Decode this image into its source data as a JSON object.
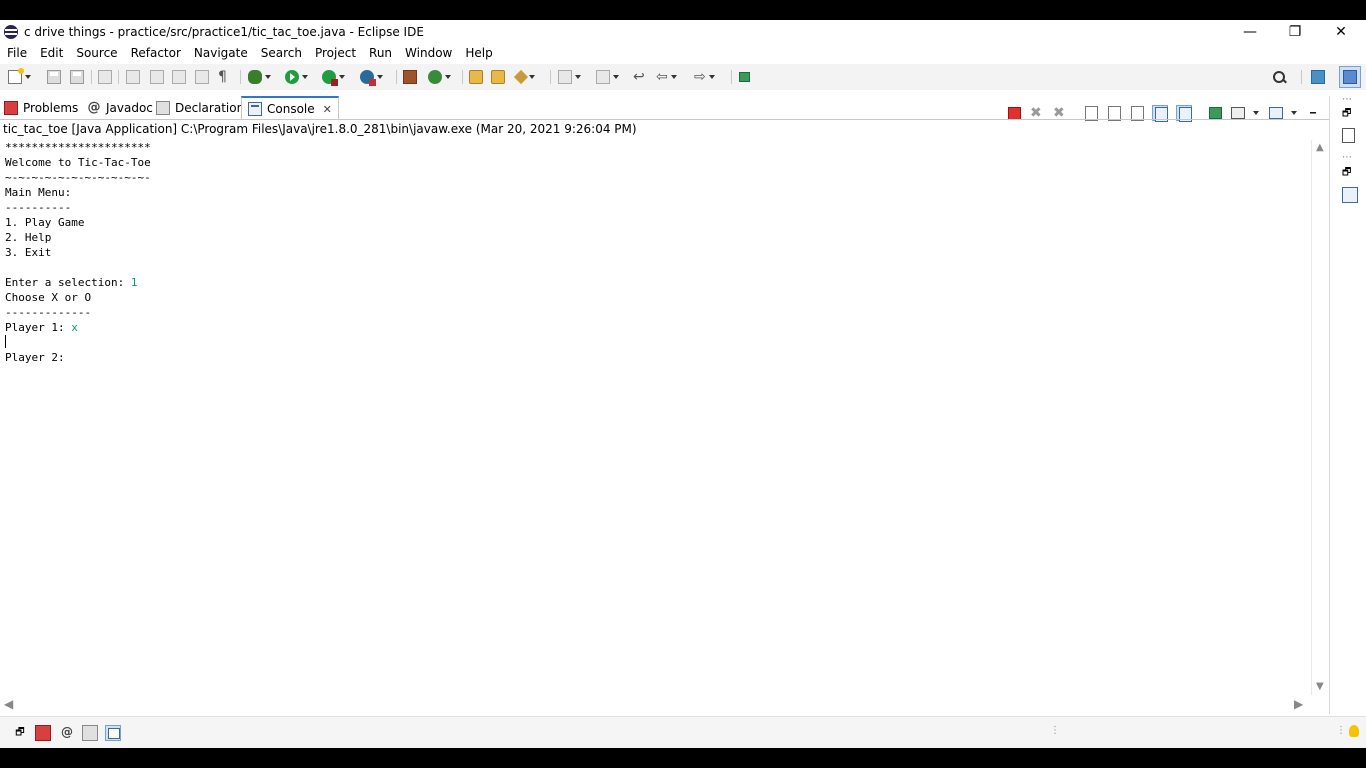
{
  "window": {
    "title": "c drive things - practice/src/practice1/tic_tac_toe.java - Eclipse IDE",
    "minimize": "—",
    "restore": "❐",
    "close": "✕"
  },
  "menu": [
    "File",
    "Edit",
    "Source",
    "Refactor",
    "Navigate",
    "Search",
    "Project",
    "Run",
    "Window",
    "Help"
  ],
  "tabs": [
    {
      "label": "Problems",
      "icon": "problems-icon"
    },
    {
      "label": "Javadoc",
      "icon": "at-icon"
    },
    {
      "label": "Declaration",
      "icon": "declaration-icon"
    },
    {
      "label": "Console",
      "icon": "console-icon",
      "active": true
    }
  ],
  "tab_close": "✕",
  "launch_info": "tic_tac_toe [Java Application] C:\\Program Files\\Java\\jre1.8.0_281\\bin\\javaw.exe  (Mar 20, 2021 9:26:04 PM)",
  "console": {
    "lines": [
      {
        "text": "**********************"
      },
      {
        "text": "Welcome to Tic-Tac-Toe"
      },
      {
        "text": "~-~-~-~-~-~-~-~-~-~-~-"
      },
      {
        "text": "Main Menu:"
      },
      {
        "text": "----------"
      },
      {
        "text": "1. Play Game"
      },
      {
        "text": "2. Help"
      },
      {
        "text": "3. Exit"
      },
      {
        "text": ""
      },
      {
        "text": "Enter a selection: ",
        "input": "1"
      },
      {
        "text": "Choose X or O"
      },
      {
        "text": "-------------"
      },
      {
        "text": "Player 1: ",
        "input": "x"
      },
      {
        "text": ""
      },
      {
        "text": "Player 2:"
      }
    ]
  },
  "scroll": {
    "up": "▲",
    "down": "▼",
    "left": "◀",
    "right": "▶"
  },
  "colors": {
    "user_input": "#0a9a6a",
    "active_tab_accent": "#2a7ac8",
    "terminate_red": "#e03030"
  }
}
